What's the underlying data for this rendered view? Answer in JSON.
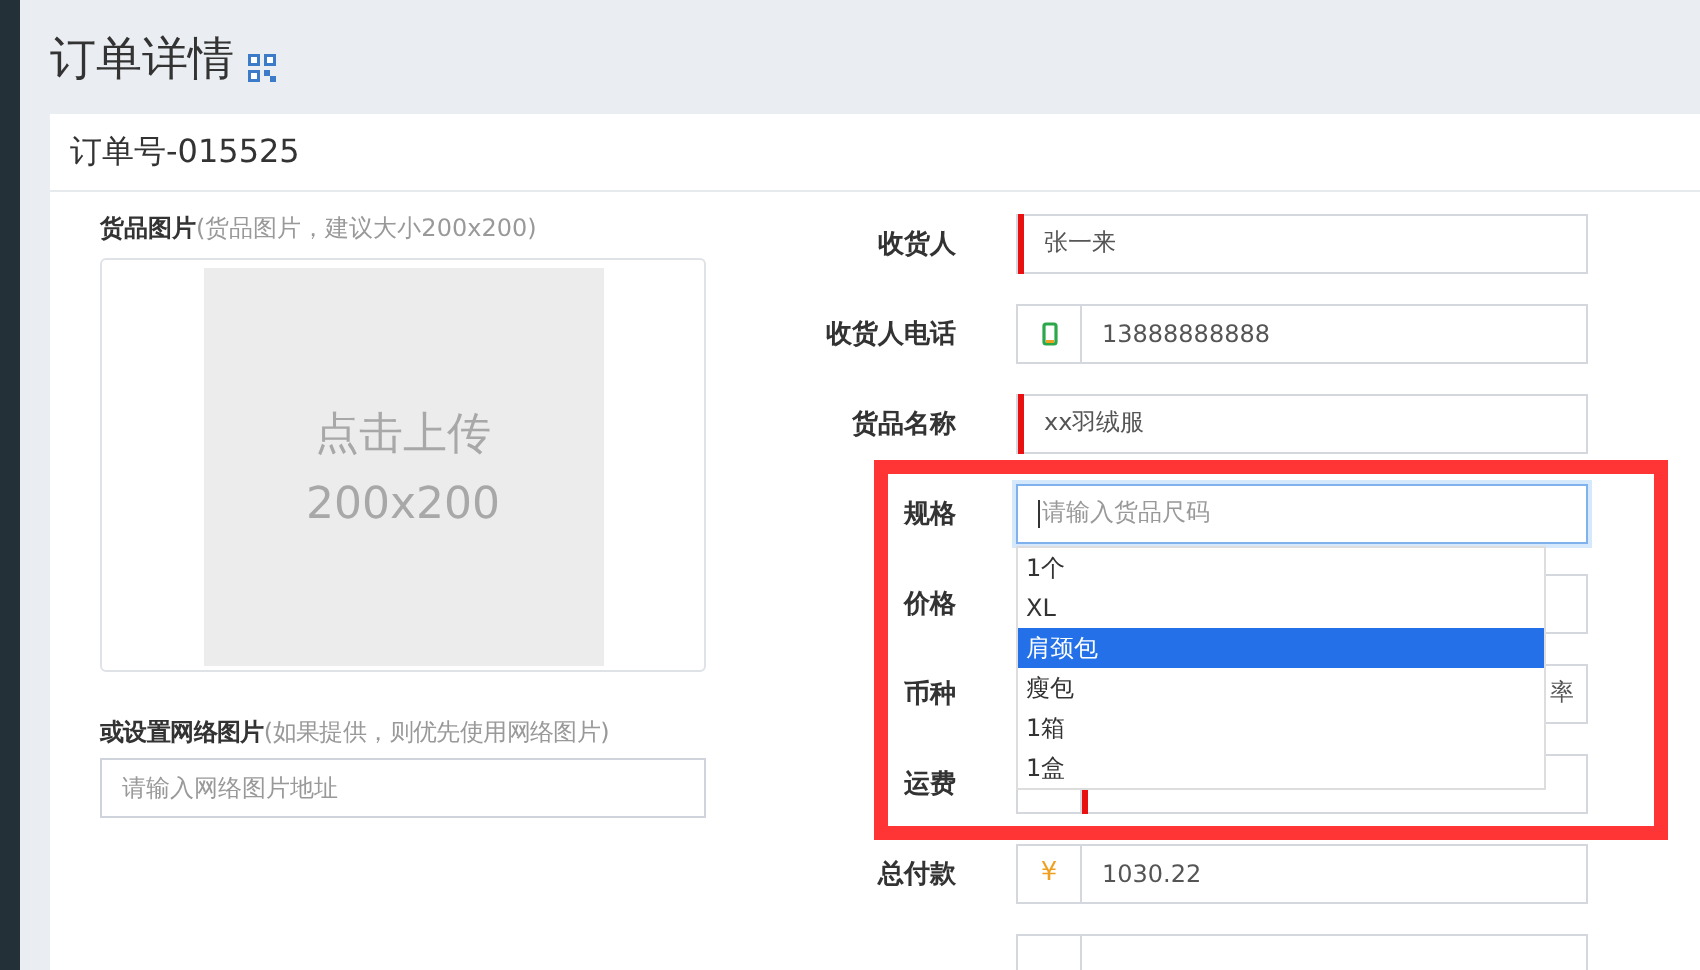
{
  "page_title": "订单详情",
  "order_no": "订单号-015525",
  "image_upload": {
    "label": "货品图片",
    "hint": "(货品图片，建议大小200x200)",
    "placeholder_lines": [
      "点击上传",
      "200x200"
    ]
  },
  "web_image": {
    "label": "或设置网络图片",
    "hint": "(如果提供，则优先使用网络图片)",
    "placeholder": "请输入网络图片地址"
  },
  "fields": [
    {
      "label": "收货人",
      "kind": "text",
      "required": true,
      "value": "张一来"
    },
    {
      "label": "收货人电话",
      "kind": "phone",
      "required": false,
      "value": "13888888888"
    },
    {
      "label": "货品名称",
      "kind": "text",
      "required": true,
      "value": "xx羽绒服"
    },
    {
      "label": "规格",
      "kind": "text",
      "required": false,
      "focused": true,
      "placeholder": "请输入货品尺码"
    },
    {
      "label": "价格",
      "kind": "text"
    },
    {
      "label": "币种",
      "kind": "text",
      "suffix": "率"
    },
    {
      "label": "运费",
      "kind": "money",
      "required": true
    },
    {
      "label": "总付款",
      "kind": "money",
      "required": false,
      "addon": "¥",
      "value": "1030.22"
    },
    {
      "kind": "money",
      "required": false
    }
  ],
  "dropdown": {
    "items": [
      {
        "label": "1个",
        "selected": false
      },
      {
        "label": "XL",
        "selected": false
      },
      {
        "label": "肩颈包",
        "selected": true
      },
      {
        "label": "瘦包",
        "selected": false
      },
      {
        "label": "1箱",
        "selected": false
      },
      {
        "label": "1盒",
        "selected": false
      }
    ]
  },
  "highlight_box": true
}
